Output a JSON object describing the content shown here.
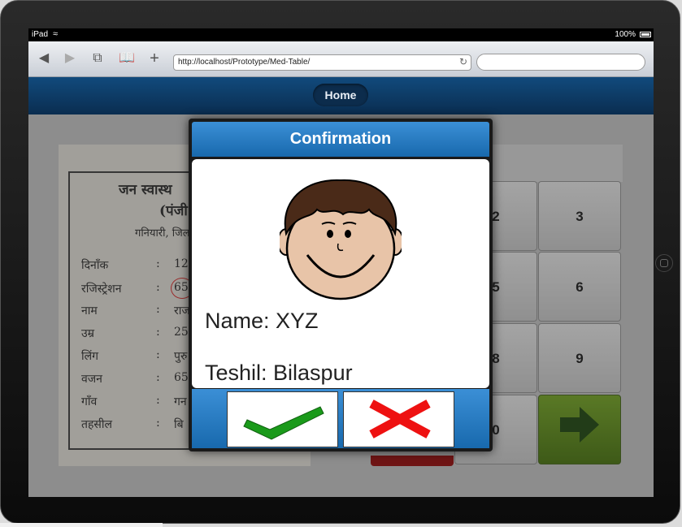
{
  "device": {
    "carrier": "iPad",
    "battery": "100%"
  },
  "browser": {
    "url": "http://localhost/Prototype/Med-Table/"
  },
  "header": {
    "home_label": "Home"
  },
  "card": {
    "title": "जन स्वास्थ",
    "subtitle": "(पंजी",
    "place": "गनियारी, जिल",
    "rows": [
      {
        "label": "दिनाँक",
        "value": "12"
      },
      {
        "label": "रजिस्ट्रेशन",
        "value": "65"
      },
      {
        "label": "नाम",
        "value": "राज"
      },
      {
        "label": "उम्र",
        "value": "25"
      },
      {
        "label": "लिंग",
        "value": "पुरु"
      },
      {
        "label": "वजन",
        "value": "65"
      },
      {
        "label": "गाँव",
        "value": "गन"
      },
      {
        "label": "तहसील",
        "value": "बि"
      }
    ]
  },
  "keypad": {
    "keys": [
      "2",
      "3",
      "5",
      "6",
      "8",
      "9",
      "0"
    ]
  },
  "dialog": {
    "title": "Confirmation",
    "name_line": "Name: XYZ",
    "tehsil_line": "Teshil: Bilaspur"
  },
  "colors": {
    "accent": "#1869ad",
    "confirm": "#1a9a1a",
    "cancel": "#ee1111",
    "go": "#4f7f0c"
  }
}
